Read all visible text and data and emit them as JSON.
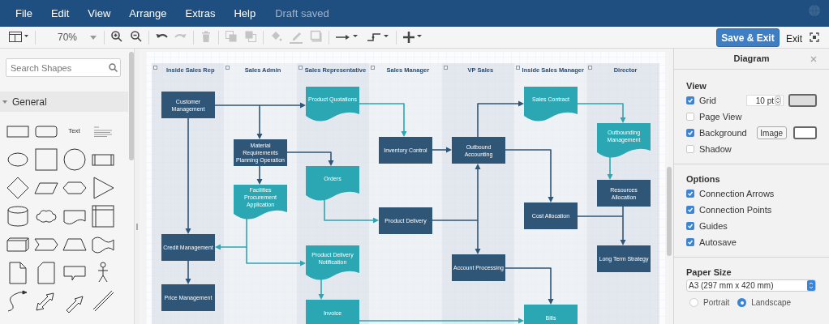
{
  "menu": {
    "items": [
      "File",
      "Edit",
      "View",
      "Arrange",
      "Extras",
      "Help"
    ],
    "status": "Draft saved"
  },
  "toolbar": {
    "groups": [
      [
        {
          "kind": "format_panel",
          "disabled": false
        }
      ],
      [
        {
          "kind": "zoom",
          "value": "70%",
          "disabled": false
        }
      ],
      [
        {
          "kind": "zoom_in",
          "disabled": false
        },
        {
          "kind": "zoom_out",
          "disabled": false
        }
      ],
      [
        {
          "kind": "undo",
          "disabled": false
        },
        {
          "kind": "redo",
          "disabled": true
        }
      ],
      [
        {
          "kind": "delete",
          "disabled": true
        }
      ],
      [
        {
          "kind": "to_front",
          "disabled": true
        },
        {
          "kind": "to_back",
          "disabled": true
        }
      ],
      [
        {
          "kind": "fill",
          "disabled": true
        },
        {
          "kind": "line_color",
          "disabled": true
        },
        {
          "kind": "shadow",
          "disabled": true
        }
      ],
      [
        {
          "kind": "connection",
          "disabled": false
        },
        {
          "kind": "waypoints",
          "disabled": false
        }
      ],
      [
        {
          "kind": "insert",
          "disabled": false
        }
      ]
    ],
    "save_button": "Save & Exit",
    "exit_link": "Exit"
  },
  "sidebar": {
    "search": {
      "placeholder": "Search Shapes"
    },
    "section": {
      "title": "General",
      "expanded": true,
      "text_shape": "Text"
    }
  },
  "diagram": {
    "lanes": [
      "Inside Sales Rep",
      "Sales Admin",
      "Sales Representative",
      "Sales Manager",
      "VP Sales",
      "Inside Sales Manager",
      "Director"
    ],
    "nodes": [
      {
        "label": "Customer Management",
        "kind": "process"
      },
      {
        "label": "Product Quotations",
        "kind": "document"
      },
      {
        "label": "Sales Contract",
        "kind": "document"
      },
      {
        "label": "Material Requirements Planning Operation",
        "kind": "process"
      },
      {
        "label": "Inventory Control",
        "kind": "process"
      },
      {
        "label": "Outbound Accounting",
        "kind": "process"
      },
      {
        "label": "Outbounding Management",
        "kind": "document"
      },
      {
        "label": "Facilities Procurement Application",
        "kind": "document"
      },
      {
        "label": "Orders",
        "kind": "document"
      },
      {
        "label": "Resources Allocation",
        "kind": "process"
      },
      {
        "label": "Product Delivery",
        "kind": "process"
      },
      {
        "label": "Cost Allocation",
        "kind": "process"
      },
      {
        "label": "Credit Management",
        "kind": "process"
      },
      {
        "label": "Product Delivery Notification",
        "kind": "document"
      },
      {
        "label": "Account Processing",
        "kind": "process"
      },
      {
        "label": "Long Term Strategy",
        "kind": "process"
      },
      {
        "label": "Price Management",
        "kind": "process"
      },
      {
        "label": "Invoice",
        "kind": "output"
      },
      {
        "label": "Bills",
        "kind": "output"
      }
    ]
  },
  "format_panel": {
    "title": "Diagram",
    "view": {
      "heading": "View",
      "options": [
        {
          "label": "Grid",
          "checked": true,
          "kind": "grid",
          "value": "10 pt"
        },
        {
          "label": "Page View",
          "checked": false,
          "kind": "plain"
        },
        {
          "label": "Background",
          "checked": true,
          "kind": "background",
          "button": "Image"
        },
        {
          "label": "Shadow",
          "checked": false,
          "kind": "plain"
        }
      ]
    },
    "options": {
      "heading": "Options",
      "items": [
        {
          "label": "Connection Arrows",
          "checked": true
        },
        {
          "label": "Connection Points",
          "checked": true
        },
        {
          "label": "Guides",
          "checked": true
        },
        {
          "label": "Autosave",
          "checked": true
        }
      ]
    },
    "paper": {
      "heading": "Paper Size",
      "value": "A3 (297 mm x 420 mm)",
      "orientations": [
        {
          "label": "Portrait",
          "selected": false
        },
        {
          "label": "Landscape",
          "selected": true
        }
      ]
    }
  }
}
